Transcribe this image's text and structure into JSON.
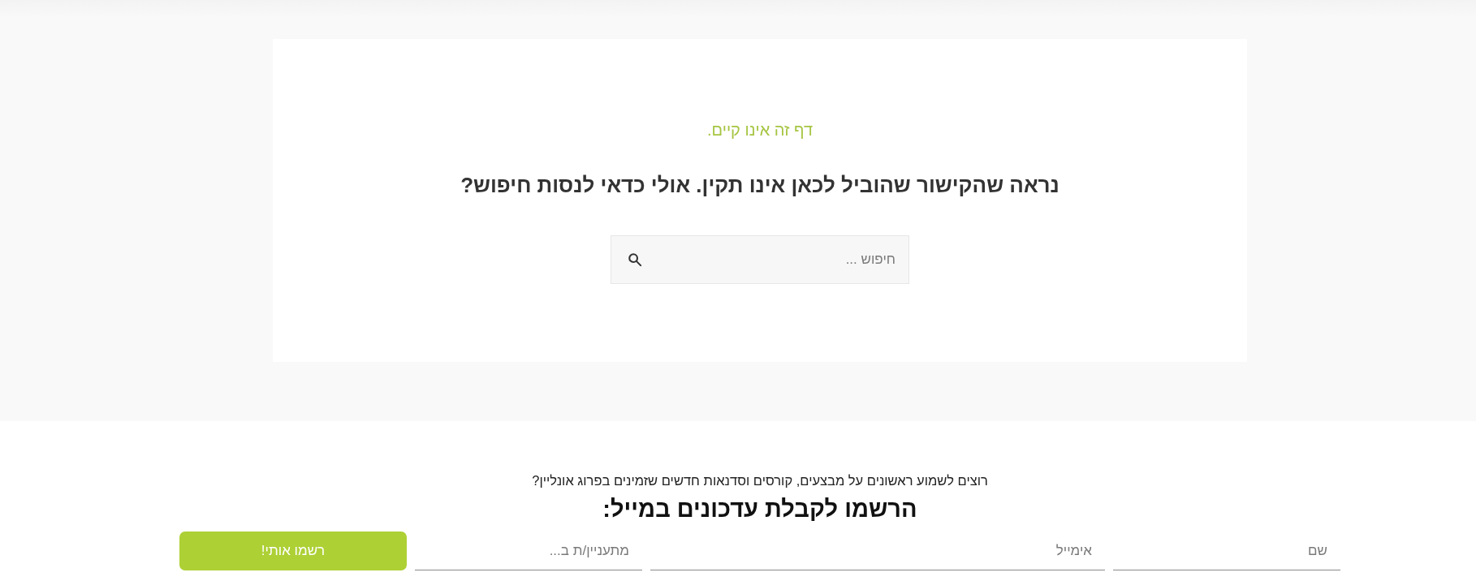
{
  "notice": {
    "title": "דף זה אינו קיים.",
    "message": "נראה שהקישור שהוביל לכאן אינו תקין. אולי כדאי לנסות חיפוש?",
    "search": {
      "placeholder": "חיפוש ..."
    }
  },
  "newsletter": {
    "intro": "רוצים לשמוע ראשונים על מבצעים, קורסים וסדנאות חדשים שזמינים בפרוג אונליין?",
    "heading": "הרשמו לקבלת עדכונים במייל:",
    "fields": [
      {
        "placeholder": "שם"
      },
      {
        "placeholder": "אימייל"
      },
      {
        "placeholder": "מתעניין/ת ב..."
      }
    ],
    "submit": "רשמו אותי!"
  }
}
